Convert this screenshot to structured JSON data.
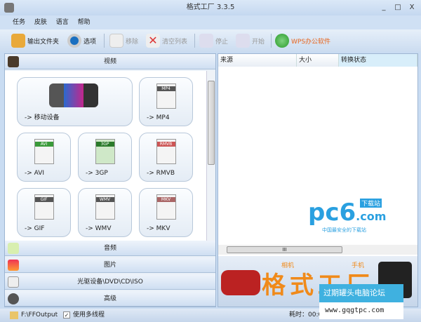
{
  "window": {
    "title": "格式工厂 3.3.5",
    "min": "_",
    "max": "□",
    "close": "X"
  },
  "menu": [
    "任务",
    "皮肤",
    "语言",
    "帮助"
  ],
  "toolbar": {
    "output_folder": "输出文件夹",
    "options": "选项",
    "remove": "移除",
    "clear_list": "清空列表",
    "stop": "停止",
    "start": "开始",
    "wps": "WPS办公软件"
  },
  "left": {
    "video_header": "视频",
    "tiles": [
      {
        "label": "-> 移动设备",
        "badge": ""
      },
      {
        "label": "-> MP4",
        "badge": "MP4"
      },
      {
        "label": "-> AVI",
        "badge": "AVI"
      },
      {
        "label": "-> 3GP",
        "badge": "3GP"
      },
      {
        "label": "-> RMVB",
        "badge": "RMVB"
      },
      {
        "label": "-> GIF",
        "badge": "GIF"
      },
      {
        "label": "-> WMV",
        "badge": "WMV"
      },
      {
        "label": "-> MKV",
        "badge": "MKV"
      }
    ],
    "categories": [
      "音频",
      "图片",
      "光驱设备\\DVD\\CD\\ISO",
      "高级"
    ]
  },
  "right": {
    "columns": [
      "来源",
      "大小",
      "转换状态"
    ],
    "logo": {
      "main": "pc6",
      "dotcom": ".com",
      "tag": "下载站",
      "sub": "中国最安全的下载站"
    },
    "banner": {
      "title": "格式工厂",
      "tag1": "相机",
      "tag2": "手机"
    },
    "scroll_grip": "III"
  },
  "watermark": {
    "line1": "过期罐头电脑论坛",
    "line2": "www.gqgtpc.com"
  },
  "status": {
    "path": "F:\\FFOutput",
    "multithread": "使用多线程",
    "multithread_checked": true,
    "elapsed": "耗时：00:00:00"
  }
}
